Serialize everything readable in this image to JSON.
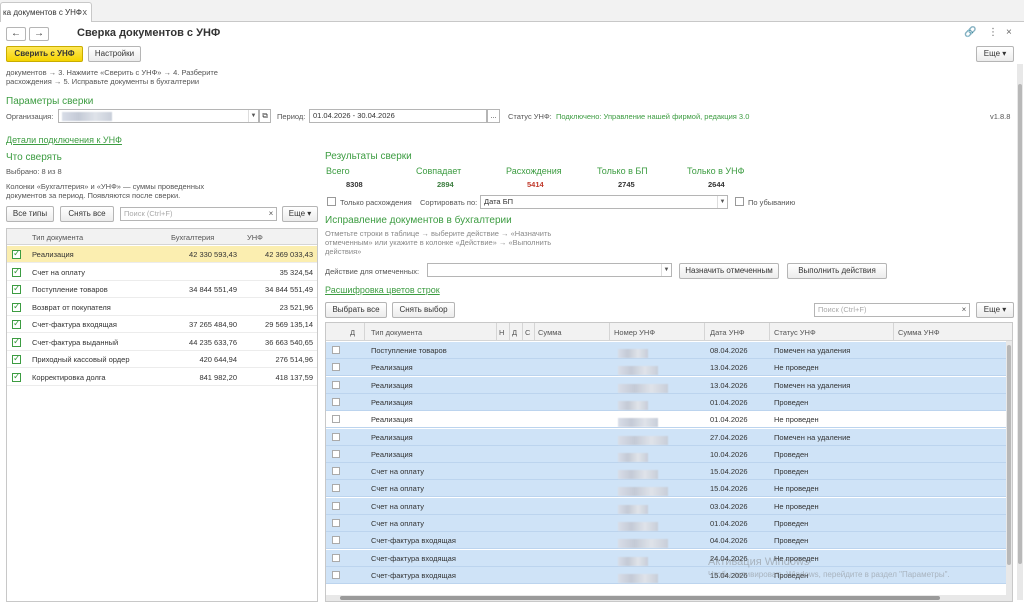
{
  "tab": {
    "label": "ка документов с УНФ",
    "close": "x"
  },
  "window": {
    "title": "Сверка документов с УНФ",
    "back": "←",
    "forward": "→",
    "link_icon": "🔗",
    "menu_icon": "⋮",
    "close_icon": "×"
  },
  "toolbar": {
    "compare_btn": "Сверить с УНФ",
    "settings_btn": "Настройки",
    "more_btn": "Еще ▾"
  },
  "hint": {
    "line1": "документов  →  3. Нажмите «Сверить с УНФ»  →  4. Разберите",
    "line2": "расхождения  →  5. Исправьте документы в бухгалтерии"
  },
  "params": {
    "header": "Параметры сверки",
    "org_label": "Организация:",
    "period_label": "Период:",
    "period_value": "01.04.2026 - 30.04.2026",
    "period_btn": "...",
    "status_label": "Статус УНФ:",
    "status_value": "Подключено: Управление нашей фирмой, редакция 3.0",
    "version": "v1.8.8",
    "details_link": "Детали подключения к УНФ"
  },
  "what": {
    "header": "Что сверять",
    "selected": "Выбрано: 8 из 8",
    "note1": "Колонки «Бухгалтерия» и «УНФ» — суммы проведенных",
    "note2": "документов за период. Появляются после сверки.",
    "all_btn": "Все типы",
    "clear_btn": "Снять все",
    "search_placeholder": "Поиск (Ctrl+F)",
    "more_btn": "Еще ▾",
    "columns": [
      "Тип документа",
      "Бухгалтерия",
      "УНФ"
    ],
    "rows": [
      {
        "type": "Реализация",
        "buh": "42 330 593,43",
        "unf": "42 369 033,43",
        "checked": true
      },
      {
        "type": "Счет на оплату",
        "buh": "",
        "unf": "35 324,54",
        "checked": true
      },
      {
        "type": "Поступление товаров",
        "buh": "34 844 551,49",
        "unf": "34 844 551,49",
        "checked": true
      },
      {
        "type": "Возврат от покупателя",
        "buh": "",
        "unf": "23 521,96",
        "checked": true
      },
      {
        "type": "Счет-фактура входящая",
        "buh": "37 265 484,90",
        "unf": "29 569 135,14",
        "checked": true
      },
      {
        "type": "Счет-фактура выданный",
        "buh": "44 235 633,76",
        "unf": "36 663 540,65",
        "checked": true
      },
      {
        "type": "Приходный кассовый ордер",
        "buh": "420 644,94",
        "unf": "276 514,96",
        "checked": true
      },
      {
        "type": "Корректировка долга",
        "buh": "841 982,20",
        "unf": "418 137,59",
        "checked": true
      }
    ]
  },
  "results": {
    "header": "Результаты сверки",
    "total_label": "Всего",
    "total": "8308",
    "match_label": "Совпадает",
    "match": "2894",
    "diff_label": "Расхождения",
    "diff": "5414",
    "only_bp_label": "Только в БП",
    "only_bp": "2745",
    "only_unf_label": "Только в УНФ",
    "only_unf": "2644",
    "only_diff_label": "Только расхождения",
    "sort_label": "Сортировать по:",
    "sort_value": "Дата БП",
    "desc_label": "По убыванию"
  },
  "fix": {
    "header": "Исправление документов в бухгалтерии",
    "note1": "Отметьте строки в таблице → выберите действие → «Назначить",
    "note2": "отмеченным» или укажите в колонке «Действие» → «Выполнить",
    "note3": "действия»",
    "action_label": "Действие для отмеченных:",
    "assign_btn": "Назначить отмеченным",
    "run_btn": "Выполнить действия",
    "legend_link": "Расшифровка цветов строк",
    "select_all_btn": "Выбрать все",
    "clear_btn": "Снять выбор",
    "search_placeholder": "Поиск (Ctrl+F)",
    "more_btn": "Еще ▾",
    "columns": [
      "Д",
      "Тип документа",
      "Н",
      "Д",
      "С",
      "Сумма",
      "Номер УНФ",
      "Дата УНФ",
      "Статус УНФ",
      "Сумма УНФ"
    ],
    "rows": [
      {
        "type": "Поступление товаров",
        "date": "08.04.2026",
        "status": "Помечен на удаления",
        "white": false
      },
      {
        "type": "Реализация",
        "date": "13.04.2026",
        "status": "Не проведен",
        "white": false
      },
      {
        "type": "Реализация",
        "date": "13.04.2026",
        "status": "Помечен на удаления",
        "white": false
      },
      {
        "type": "Реализация",
        "date": "01.04.2026",
        "status": "Проведен",
        "white": false
      },
      {
        "type": "Реализация",
        "date": "01.04.2026",
        "status": "Не проведен",
        "white": true
      },
      {
        "type": "Реализация",
        "date": "27.04.2026",
        "status": "Помечен на удаление",
        "white": false
      },
      {
        "type": "Реализация",
        "date": "10.04.2026",
        "status": "Проведен",
        "white": false
      },
      {
        "type": "Счет на оплату",
        "date": "15.04.2026",
        "status": "Проведен",
        "white": false
      },
      {
        "type": "Счет на оплату",
        "date": "15.04.2026",
        "status": "Не проведен",
        "white": false
      },
      {
        "type": "Счет на оплату",
        "date": "03.04.2026",
        "status": "Не проведен",
        "white": false
      },
      {
        "type": "Счет на оплату",
        "date": "01.04.2026",
        "status": "Проведен",
        "white": false
      },
      {
        "type": "Счет-фактура входящая",
        "date": "04.04.2026",
        "status": "Проведен",
        "white": false
      },
      {
        "type": "Счет-фактура входящая",
        "date": "24.04.2026",
        "status": "Не проведен",
        "white": false
      },
      {
        "type": "Счет-фактура входящая",
        "date": "15.04.2026",
        "status": "Проведен",
        "white": false
      }
    ]
  },
  "watermark": {
    "line1": "Активация Windows",
    "line2": "Чтобы активировать Windows, перейдите в раздел \"Параметры\"."
  }
}
